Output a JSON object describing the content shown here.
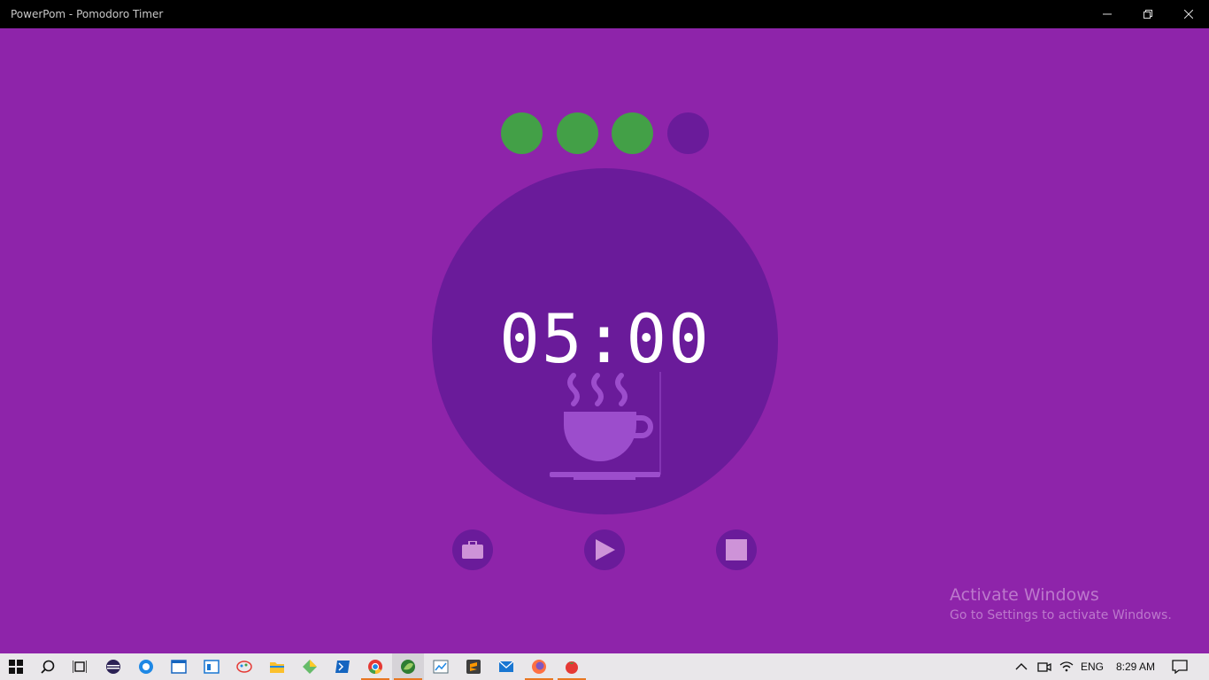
{
  "window": {
    "title": "PowerPom - Pomodoro Timer",
    "controls": [
      "minimize",
      "restore",
      "close"
    ]
  },
  "sessions": {
    "completed": 3,
    "total": 4,
    "colors": {
      "done": "#43a047",
      "pending": "#6a1b9a"
    }
  },
  "timer": {
    "time": "05:00",
    "mode_icon": "coffee-cup-icon"
  },
  "controls": {
    "work": "briefcase-icon",
    "play": "play-icon",
    "stop": "stop-icon"
  },
  "watermark": {
    "line1": "Activate Windows",
    "line2": "Go to Settings to activate Windows."
  },
  "taskbar": {
    "apps": [
      "start-icon",
      "search-icon",
      "task-view-icon",
      "eclipse-icon",
      "app-bird-icon",
      "app-window-icon",
      "app-window2-icon",
      "paint-icon",
      "file-explorer-icon",
      "app-diamond-icon",
      "powershell-icon",
      "chrome-icon",
      "app-leaf-icon",
      "app-chart-icon",
      "sublime-icon",
      "mail-icon",
      "firefox-icon",
      "tomato-icon"
    ],
    "tray": {
      "language": "ENG",
      "clock": "8:29 AM"
    }
  },
  "colors": {
    "background": "#8e24aa",
    "circle": "#6a1b9a",
    "accent_button": "#ce93d8"
  }
}
